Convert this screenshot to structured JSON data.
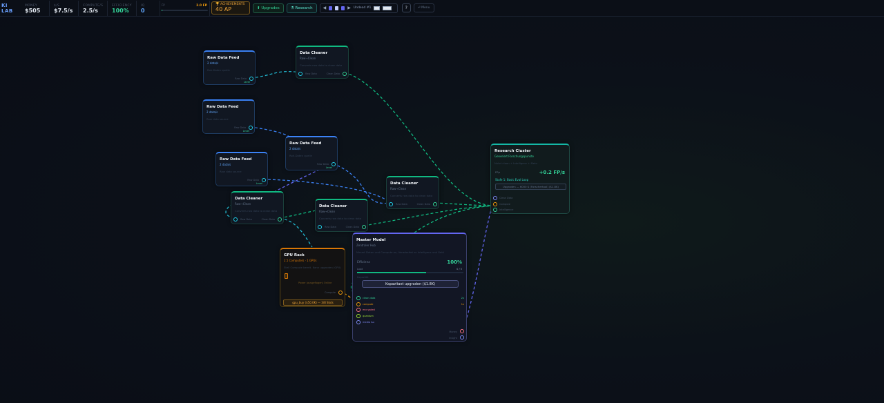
{
  "app": {
    "brand": "KI LAB"
  },
  "stats": [
    {
      "label": "MONEY",
      "value": "$505",
      "tone": "white"
    },
    {
      "label": "$/S",
      "value": "$7.5/s",
      "tone": "white"
    },
    {
      "label": "COMPUTE/S",
      "value": "2.5/s",
      "tone": "white"
    },
    {
      "label": "EFFICIENCY",
      "value": "100%",
      "tone": "green"
    },
    {
      "label": "IQ",
      "value": "0",
      "tone": "blue"
    }
  ],
  "fp": {
    "label": "FP",
    "value": "2.0 FP",
    "progress": 0.02
  },
  "achievements": {
    "label": "🏆 ACHIEVEMENTS",
    "value": "40 AP"
  },
  "toolbar": {
    "upgrades": "⬆ Upgrades",
    "research": "⚗ Research",
    "slots_label": "Undead #1",
    "help": "?",
    "menu": "⏎ Menu"
  },
  "colors": {
    "feed": "#3b82f6",
    "cleaner": "#10b981",
    "gpu": "#d97706",
    "master": "#6366f1",
    "research": "#14b8a6",
    "wire_cyan": "#22b8cf",
    "wire_blue": "#6366f1",
    "wire_green": "#10b981"
  },
  "nodes": {
    "feed1": {
      "title": "Raw Data Feed",
      "sub": "2 data/s",
      "desc": "Roh-Daten quelle",
      "out": "Raw Data",
      "lvl": "Level"
    },
    "feed2": {
      "title": "Raw Data Feed",
      "sub": "2 data/s",
      "desc": "Raw data source",
      "out": "Raw Data",
      "lvl": "Level"
    },
    "feed3": {
      "title": "Raw Data Feed",
      "sub": "2 data/s",
      "desc": "Roh-Daten quelle",
      "out": "Raw Data",
      "lvl": "Level"
    },
    "feed4": {
      "title": "Raw Data Feed",
      "sub": "2 data/s",
      "desc": "Raw data source",
      "out": "Raw Data",
      "lvl": "Level"
    },
    "clean1": {
      "title": "Data Cleaner",
      "sub": "Raw→Clean",
      "desc": "Converts raw data to clean data",
      "in": "Raw Data",
      "out": "Clean Data"
    },
    "clean2": {
      "title": "Data Cleaner",
      "sub": "Raw→Clean",
      "desc": "Converts raw data to clean data",
      "in": "Raw Data",
      "out": "Clean Data"
    },
    "clean3": {
      "title": "Data Cleaner",
      "sub": "Raw→Clean",
      "desc": "Converts raw data to clean data",
      "in": "Raw Data",
      "out": "Clean Data"
    },
    "clean4": {
      "title": "Data Cleaner",
      "sub": "Raw→Clean",
      "desc": "Converts raw data to clean data",
      "in": "Raw Data",
      "out": "Clean Data"
    },
    "gpu": {
      "title": "GPU Rack",
      "sub": "2.5 Compute/s · 1 GPUs",
      "desc": "Stell Compute bereit. Kann upgraden (GPU)",
      "status": "Power (ausgeflogen) Online",
      "out": "Compute",
      "buy": "gpu_buy ($50.0K) — 3/8 Slots"
    },
    "master": {
      "title": "Master Model",
      "sub": "Zentraler Hub",
      "desc": "Nimmt Daten und Compute an, Verarbeitet zu Intelligenz und Geld",
      "eff_label": "Effizienz",
      "eff_value": "100%",
      "eff_fill": 1.0,
      "load_label": "Load",
      "load_value": "0 / 5",
      "load_fill": 0.65,
      "cap_label": "Kapazität",
      "upgrade": "Kapazitaet upgraden ($1.8K)",
      "inputs": [
        {
          "label": "clean data",
          "val": "2x",
          "color": "green"
        },
        {
          "label": "compute",
          "val": "1x",
          "color": "orange"
        },
        {
          "label": "encrypted",
          "val": "",
          "color": "red"
        },
        {
          "label": "quantum",
          "val": "",
          "color": "lime"
        },
        {
          "label": "media isu",
          "val": "",
          "color": "blue"
        }
      ],
      "outputs": [
        {
          "label": "Money",
          "color": "red"
        },
        {
          "label": "Insight",
          "color": "blue"
        }
      ]
    },
    "research": {
      "title": "Research Cluster",
      "sub": "Generiert Forschungspunkte",
      "desc": "Nutzt clean + Intelligenz + Mehr",
      "rate_label": "FP/s",
      "rate": "+0.2 FP/s",
      "stage": "Stufe 1: Basic Eval Loop",
      "upgrade": "Upgraden — 6000 $ (Forschertool) ($1.8K)",
      "inputs": [
        {
          "label": "Clean Data",
          "color": "blue"
        },
        {
          "label": "Compute",
          "color": "orange"
        },
        {
          "label": "Intelligence",
          "color": "green"
        }
      ]
    }
  }
}
